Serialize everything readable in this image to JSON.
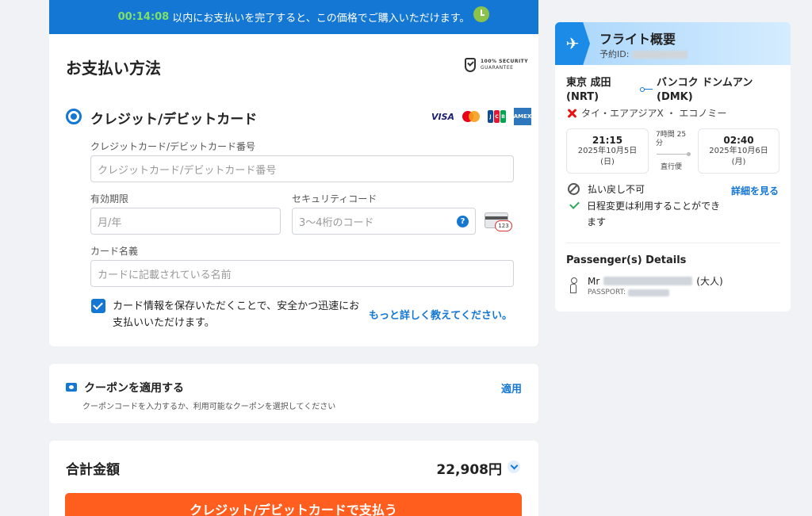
{
  "timer": {
    "countdown": "00:14:08",
    "message": "以内にお支払いを完了すると、この価格でご購入いただけます。"
  },
  "payment": {
    "title": "お支払い方法",
    "guarantee_line1": "100% SECURITY",
    "guarantee_line2": "GUARANTEE",
    "method_label": "クレジット/デビットカード",
    "brands": [
      "VISA",
      "Mastercard",
      "JCB",
      "AMEX"
    ],
    "card_number_label": "クレジットカード/デビットカード番号",
    "card_number_placeholder": "クレジットカード/デビットカード番号",
    "expiry_label": "有効期限",
    "expiry_placeholder": "月/年",
    "cvv_label": "セキュリティコード",
    "cvv_placeholder": "3〜4桁のコード",
    "cvv_help": "?",
    "cvv_card_text": "123",
    "name_label": "カード名義",
    "name_placeholder": "カードに記載されている名前",
    "save_text": "カード情報を保存いただくことで、安全かつ迅速にお支払いいただけます。",
    "save_checked": true,
    "learn_more": "もっと詳しく教えてください。"
  },
  "coupon": {
    "title": "クーポンを適用する",
    "subtitle": "クーポンコードを入力するか、利用可能なクーポンを選択してください",
    "apply": "適用"
  },
  "total": {
    "label": "合計金額",
    "amount": "22,908円",
    "pay_button": "クレジット/デビットカードで支払う"
  },
  "flight": {
    "title": "フライト概要",
    "booking_id_label": "予約ID:",
    "from_city": "東京 成田",
    "from_code": "(NRT)",
    "to_city": "バンコク ドンムアン",
    "to_code": "(DMK)",
    "airline": "タイ・エアアジアX ・ エコノミー",
    "depart_time": "21:15",
    "depart_date": "2025年10月5日",
    "depart_day": "(日)",
    "duration": "7時間 25 分",
    "direct": "直行便",
    "arrive_time": "02:40",
    "arrive_date": "2025年10月6日",
    "arrive_day": "(月)",
    "no_refund": "払い戻し不可",
    "change_note": "日程変更は利用することができます",
    "details_link": "詳細を見る",
    "passenger_title": "Passenger(s) Details",
    "passenger_prefix": "Mr",
    "passenger_type": "(大人)",
    "passport_label": "PASSPORT:"
  },
  "colors": {
    "primary": "#1577d4",
    "pay_button": "#ff5e1f",
    "timer_count": "#7ee06b"
  }
}
